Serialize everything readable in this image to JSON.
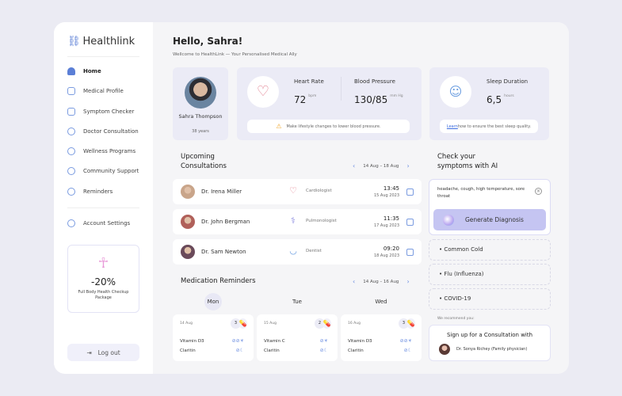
{
  "app": {
    "logo": "Healthlink"
  },
  "sidebar": {
    "items": [
      {
        "label": "Home",
        "icon": "home-icon"
      },
      {
        "label": "Medical Profile",
        "icon": "clipboard-icon"
      },
      {
        "label": "Symptom Checker",
        "icon": "checklist-icon"
      },
      {
        "label": "Doctor Consultation",
        "icon": "phone-icon"
      },
      {
        "label": "Wellness Programs",
        "icon": "wellness-icon"
      },
      {
        "label": "Community Support",
        "icon": "community-icon"
      },
      {
        "label": "Reminders",
        "icon": "alarm-icon"
      }
    ],
    "account_settings": "Account Settings",
    "promo": {
      "discount": "-20%",
      "text": "Full Body Health Checkup Package"
    },
    "logout": "Log out"
  },
  "header": {
    "title": "Hello, Sahra!",
    "subtitle": "Wellcome to HealthLink — Your Personalised Medical Ally"
  },
  "profile": {
    "name": "Sahra Thompson",
    "age": "38 years"
  },
  "vitals": {
    "heart_rate": {
      "label": "Heart Rate",
      "value": "72",
      "unit": "bpm"
    },
    "blood_pressure": {
      "label": "Blood Pressure",
      "value": "130/85",
      "unit": "mm Hg"
    },
    "note": "Make lifestyle changes to lower blood pressure."
  },
  "sleep": {
    "label": "Sleep Duration",
    "value": "6,5",
    "unit": "hours",
    "link": "Learn",
    "note": " how to ensure the best sleep quality."
  },
  "consultations": {
    "title1": "Upcoming",
    "title2": "Consultations",
    "range": "14 Aug – 18 Aug",
    "items": [
      {
        "doctor": "Dr. Irena Miller",
        "specialty": "Cardiologist",
        "time": "13:45",
        "date": "15 Aug 2023",
        "avatar_color": "#c9a58a",
        "icon": "♡",
        "icon_color": "#e07a8a"
      },
      {
        "doctor": "Dr. John Bergman",
        "specialty": "Pulmonologist",
        "time": "11:35",
        "date": "17 Aug 2023",
        "avatar_color": "#b0605a",
        "icon": "⚕",
        "icon_color": "#8a8ae0"
      },
      {
        "doctor": "Dr. Sam Newton",
        "specialty": "Dentist",
        "time": "09:20",
        "date": "18 Aug 2023",
        "avatar_color": "#6a4a5a",
        "icon": "◡",
        "icon_color": "#6a9de0"
      }
    ]
  },
  "medication": {
    "title": "Medication Reminders",
    "range": "14 Aug – 16 Aug",
    "days": [
      {
        "day": "Mon",
        "date": "14 Aug",
        "count": "3",
        "meds": [
          {
            "name": "Vitamin D3",
            "icons": "⊘⊘☀"
          },
          {
            "name": "Claritin",
            "icons": "⊘☾"
          }
        ]
      },
      {
        "day": "Tue",
        "date": "15 Aug",
        "count": "2",
        "meds": [
          {
            "name": "Vitamin C",
            "icons": "⊘☀"
          },
          {
            "name": "Claritin",
            "icons": "⊘☾"
          }
        ]
      },
      {
        "day": "Wed",
        "date": "16 Aug",
        "count": "3",
        "meds": [
          {
            "name": "Vitamin D3",
            "icons": "⊘⊘☀"
          },
          {
            "name": "Claritin",
            "icons": "⊘☾"
          }
        ]
      }
    ]
  },
  "ai": {
    "title1": "Check your",
    "title2": "symptoms with AI",
    "input": "headache, cough, high temperature, sore throat",
    "button": "Generate Diagnosis",
    "results": [
      "Common Cold",
      "Flu (Influenza)",
      "COVID-19"
    ],
    "recommend": "We recommend you:",
    "signup": "Sign up for a Consultation with",
    "doctor": "Dr. Sonya Richey (Family physician)"
  }
}
